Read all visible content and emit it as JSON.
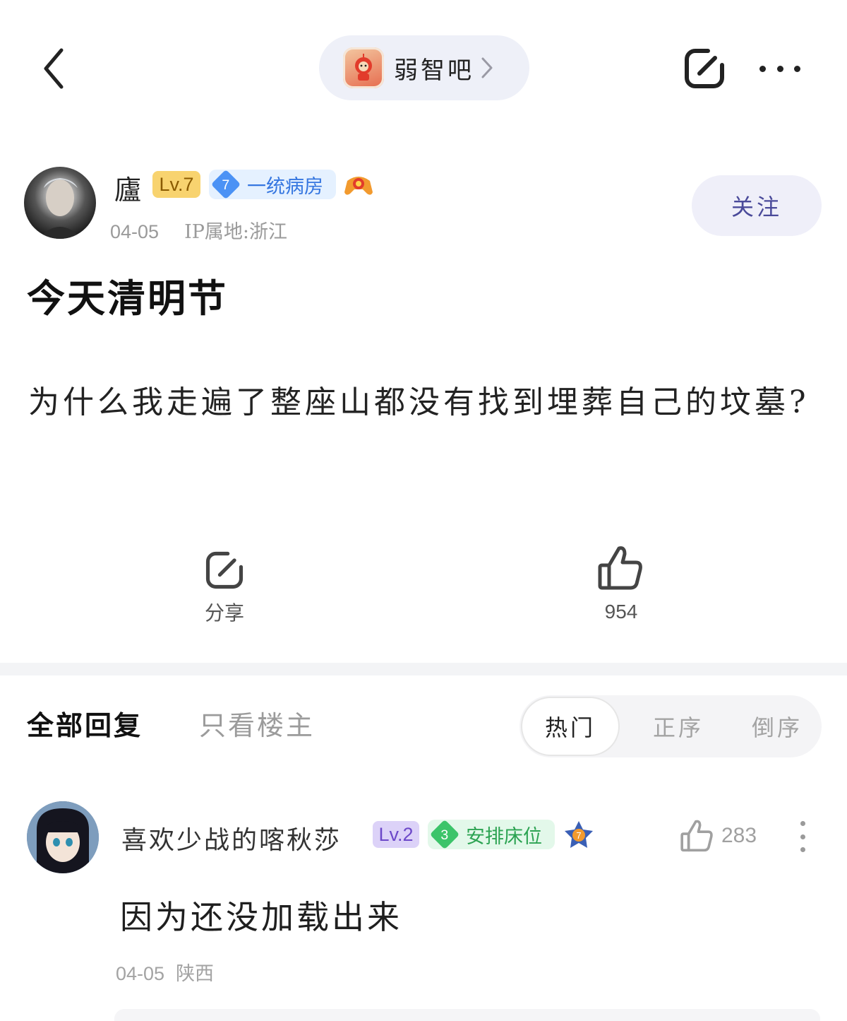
{
  "header": {
    "forum_name": "弱智吧",
    "forum_icon": "teletubby-forum-icon",
    "icons": [
      "back-arrow-icon",
      "chevron-right-icon",
      "share-icon",
      "more-icon"
    ]
  },
  "author": {
    "name": "廬",
    "level": "Lv.7",
    "rank_number": "7",
    "rank_title": "一统病房",
    "date": "04-05",
    "ip_location": "IP属地:浙江",
    "follow_label": "关注",
    "medal_icon": "game-controller-medal-icon"
  },
  "post": {
    "title": "今天清明节",
    "body": "为什么我走遍了整座山都没有找到埋葬自己的坟墓?"
  },
  "actions": {
    "share_label": "分享",
    "like_count": "954"
  },
  "reply_tabs": {
    "all_label": "全部回复",
    "op_only_label": "只看楼主",
    "sort_options": [
      "热门",
      "正序",
      "倒序"
    ],
    "selected_sort": "热门"
  },
  "comment": {
    "user": "喜欢少战的喀秋莎",
    "level": "Lv.2",
    "rank_number": "3",
    "rank_title": "安排床位",
    "like_count": "283",
    "text": "因为还没加载出来",
    "date": "04-05",
    "location": "陕西"
  },
  "colors": {
    "accent_follow": "#4a4a9a",
    "level7": "#f8d36f",
    "level2": "#dcd2f8",
    "rank_blue": "#4b92f5",
    "rank_green": "#3cc46a"
  }
}
